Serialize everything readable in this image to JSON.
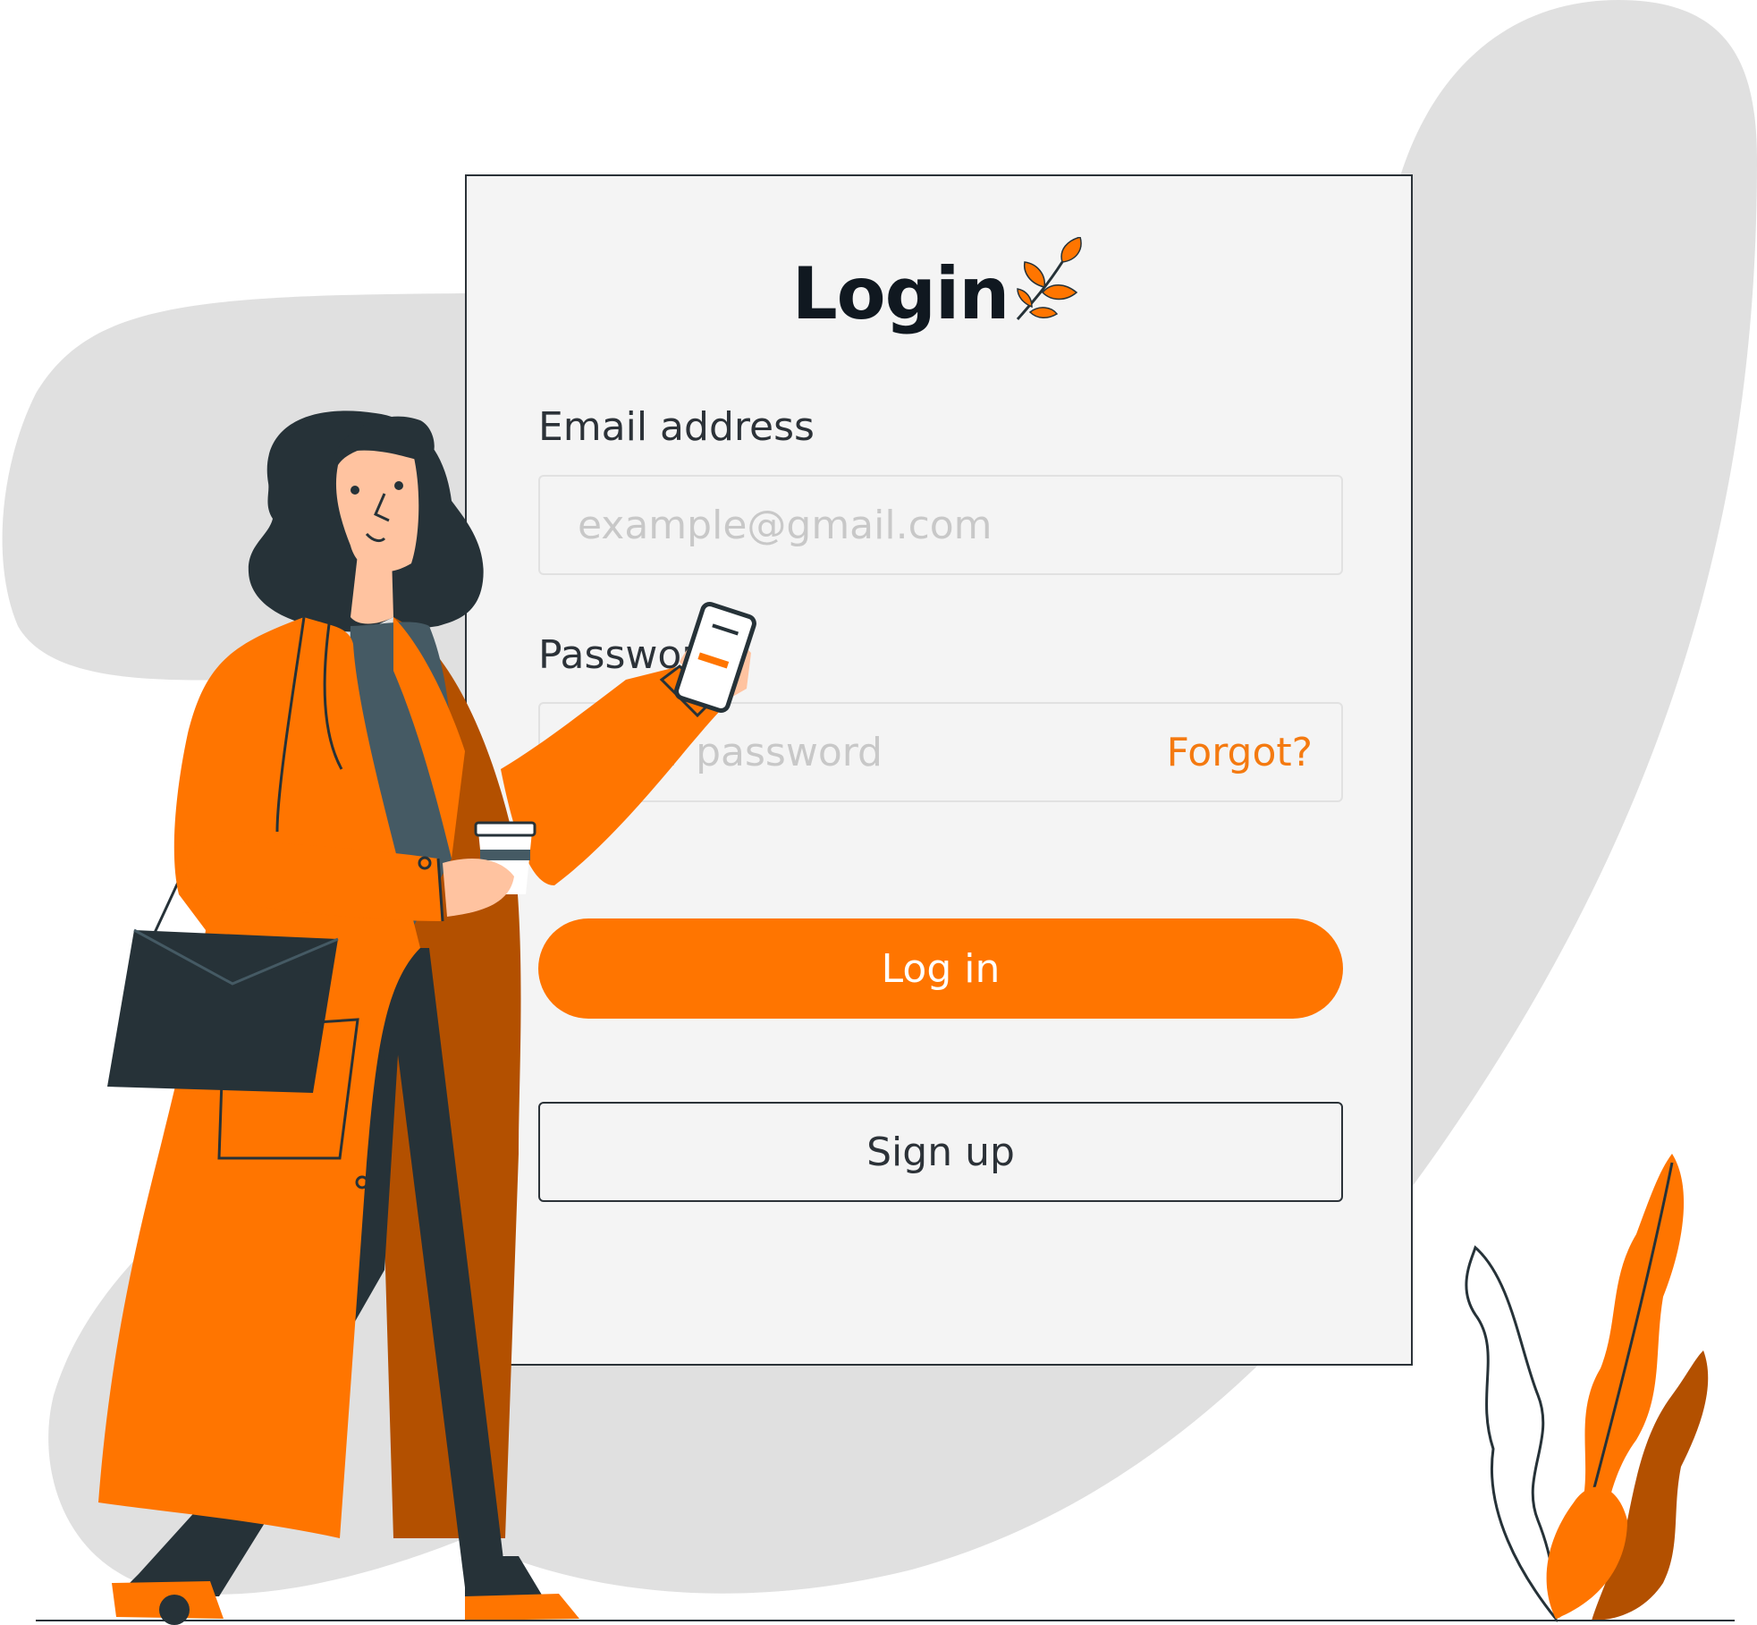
{
  "form": {
    "title": "Login",
    "email_label": "Email address",
    "email_placeholder": "example@gmail.com",
    "password_label": "Password",
    "password_placeholder": "Enter password",
    "forgot_label": "Forgot?",
    "login_label": "Log in",
    "signup_label": "Sign up"
  },
  "colors": {
    "accent": "#ff7500",
    "dark": "#263238",
    "card": "#f4f4f4",
    "blob": "#e0e0e0"
  },
  "icons": {
    "logo": "leaf-icon"
  }
}
